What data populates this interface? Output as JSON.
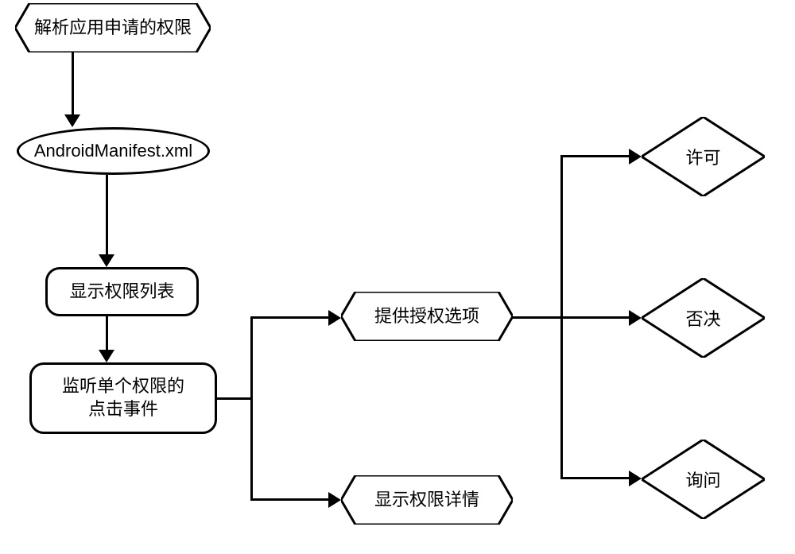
{
  "nodes": {
    "parse_permissions": "解析应用申请的权限",
    "manifest_file": "AndroidManifest.xml",
    "display_list": "显示权限列表",
    "listen_click": "监听单个权限的\n点击事件",
    "provide_options": "提供授权选项",
    "show_details": "显示权限详情",
    "allow": "许可",
    "deny": "否决",
    "ask": "询问"
  }
}
